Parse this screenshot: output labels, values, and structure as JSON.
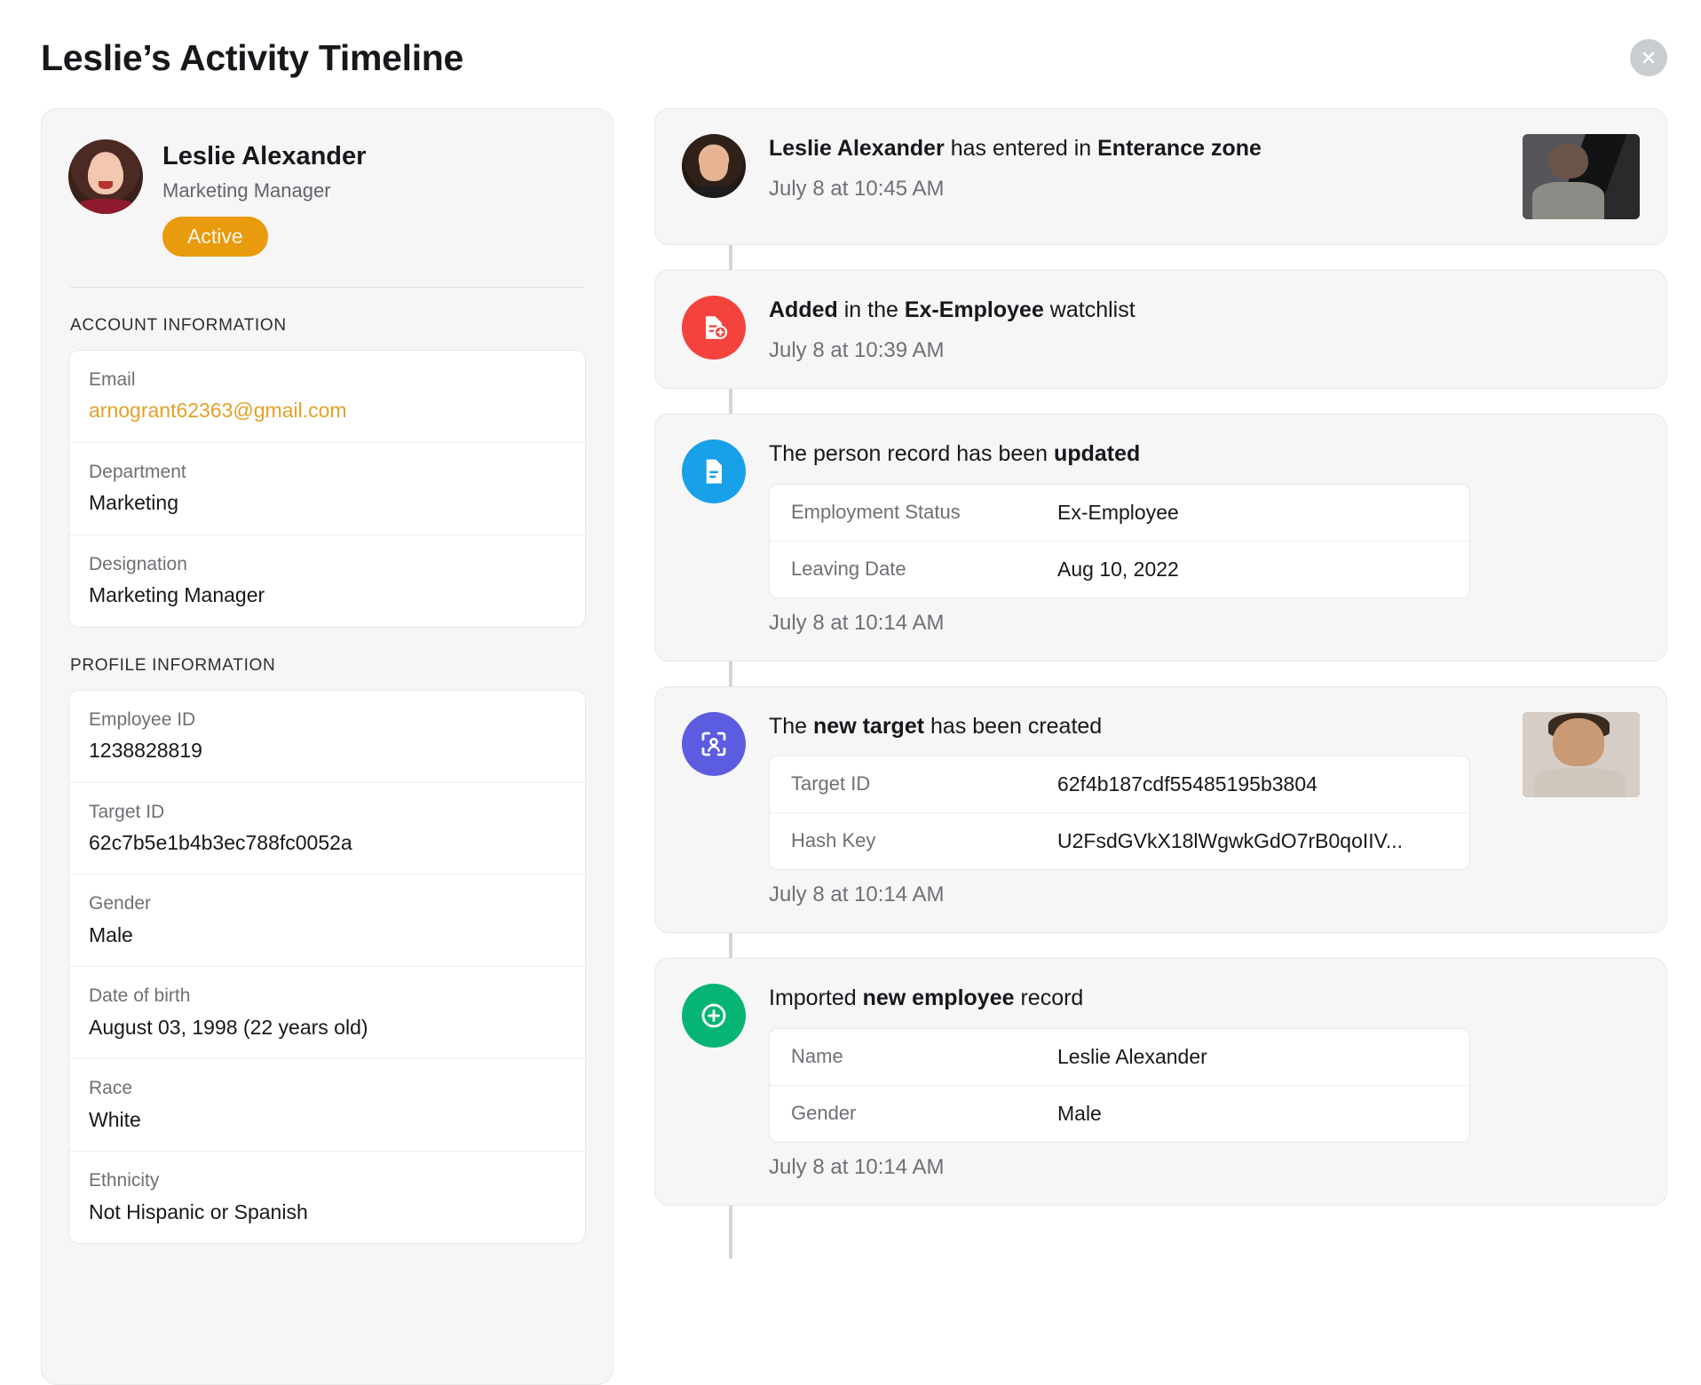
{
  "header": {
    "title": "Leslie’s Activity Timeline",
    "close_label": "×"
  },
  "profile": {
    "name": "Leslie Alexander",
    "role": "Marketing Manager",
    "status": "Active",
    "account_section_label": "ACCOUNT INFORMATION",
    "profile_section_label": "PROFILE INFORMATION",
    "account_fields": [
      {
        "label": "Email",
        "value": "arnogrant62363@gmail.com",
        "is_link": true
      },
      {
        "label": "Department",
        "value": "Marketing",
        "is_link": false
      },
      {
        "label": "Designation",
        "value": "Marketing Manager",
        "is_link": false
      }
    ],
    "profile_fields": [
      {
        "label": "Employee ID",
        "value": "1238828819"
      },
      {
        "label": "Target ID",
        "value": "62c7b5e1b4b3ec788fc0052a"
      },
      {
        "label": "Gender",
        "value": "Male"
      },
      {
        "label": "Date of birth",
        "value": "August 03, 1998 (22 years old)"
      },
      {
        "label": "Race",
        "value": "White"
      },
      {
        "label": "Ethnicity",
        "value": "Not Hispanic or Spanish"
      }
    ]
  },
  "timeline": {
    "items": [
      {
        "icon": "person-photo-icon",
        "icon_kind": "photo",
        "text_parts": [
          {
            "t": "Leslie Alexander",
            "b": true
          },
          {
            "t": " has entered in ",
            "b": false
          },
          {
            "t": "Enterance zone",
            "b": true
          }
        ],
        "time": "July 8 at 10:45 AM",
        "thumb": "dark",
        "rows": []
      },
      {
        "icon": "document-add-icon",
        "icon_kind": "red",
        "text_parts": [
          {
            "t": "Added",
            "b": true
          },
          {
            "t": " in the ",
            "b": false
          },
          {
            "t": "Ex-Employee",
            "b": true
          },
          {
            "t": " watchlist",
            "b": false
          }
        ],
        "time": "July 8 at 10:39 AM",
        "thumb": "",
        "rows": []
      },
      {
        "icon": "document-icon",
        "icon_kind": "blue",
        "text_parts": [
          {
            "t": "The person record has been ",
            "b": false
          },
          {
            "t": "updated",
            "b": true
          }
        ],
        "time": "July 8 at 10:14 AM",
        "thumb": "",
        "rows": [
          {
            "key": "Employment Status",
            "value": "Ex-Employee"
          },
          {
            "key": "Leaving Date",
            "value": "Aug 10, 2022"
          }
        ]
      },
      {
        "icon": "face-scan-icon",
        "icon_kind": "purple",
        "text_parts": [
          {
            "t": "The ",
            "b": false
          },
          {
            "t": "new target",
            "b": true
          },
          {
            "t": " has been created",
            "b": false
          }
        ],
        "time": "July 8 at 10:14 AM",
        "thumb": "warm",
        "rows": [
          {
            "key": "Target ID",
            "value": "62f4b187cdf55485195b3804"
          },
          {
            "key": "Hash Key",
            "value": "U2FsdGVkX18lWgwkGdO7rB0qoIIV..."
          }
        ]
      },
      {
        "icon": "plus-circle-icon",
        "icon_kind": "green",
        "text_parts": [
          {
            "t": "Imported ",
            "b": false
          },
          {
            "t": "new employee",
            "b": true
          },
          {
            "t": " record",
            "b": false
          }
        ],
        "time": "July 8 at 10:14 AM",
        "thumb": "",
        "rows": [
          {
            "key": "Name",
            "value": "Leslie Alexander"
          },
          {
            "key": "Gender",
            "value": "Male"
          }
        ]
      }
    ]
  }
}
